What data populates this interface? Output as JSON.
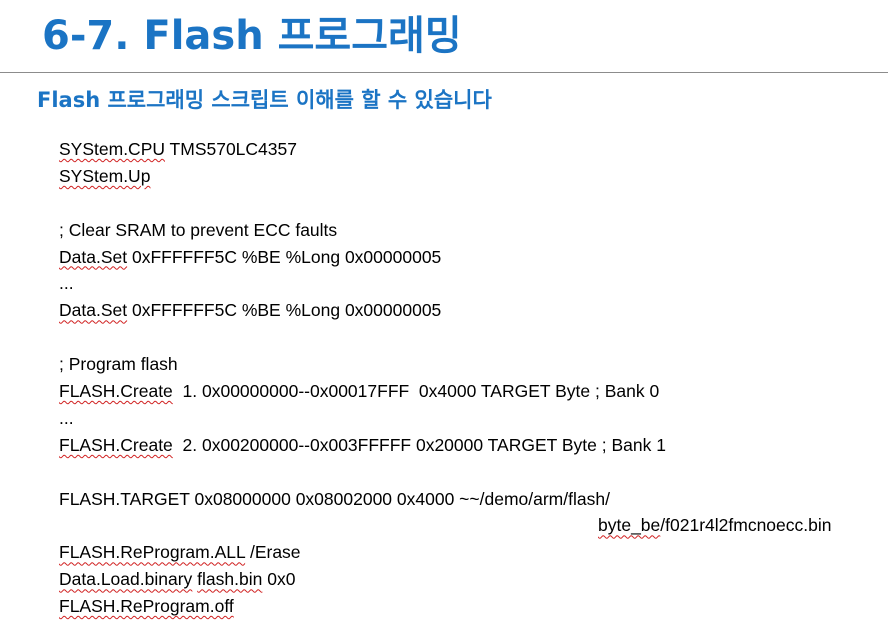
{
  "slide": {
    "title": "6-7. Flash 프로그래밍",
    "subtitle": "Flash 프로그래밍 스크립트 이해를 할 수 있습니다"
  },
  "script": {
    "l01a": "SYStem.CPU",
    "l01b": " TMS570LC4357",
    "l02a": "SYStem.Up",
    "l04": "; Clear SRAM to prevent ECC faults",
    "l05a": "Data.Set",
    "l05b": " 0xFFFFFF5C %BE %Long 0x00000005",
    "l06": "...",
    "l07a": "Data.Set",
    "l07b": " 0xFFFFFF5C %BE %Long 0x00000005",
    "l09": "; Program flash",
    "l10a": "FLASH.Create",
    "l10b": "  1. 0x00000000--0x00017FFF  0x4000 TARGET Byte ; Bank 0",
    "l11": "...",
    "l12a": "FLASH.Create",
    "l12b": "  2. 0x00200000--0x003FFFFF 0x20000 TARGET Byte ; Bank 1",
    "l14": "FLASH.TARGET 0x08000000 0x08002000 0x4000 ~~/demo/arm/flash/",
    "l15a": "byte_be",
    "l15b": "/f021r4l2fmcnoecc.bin",
    "l16a": "FLASH.ReProgram.ALL",
    "l16b": " /Erase",
    "l17a": "Data.Load.binary",
    "l17b": " ",
    "l17c": "flash.bin",
    "l17d": " 0x0",
    "l18a": "FLASH.ReProgram.off"
  }
}
